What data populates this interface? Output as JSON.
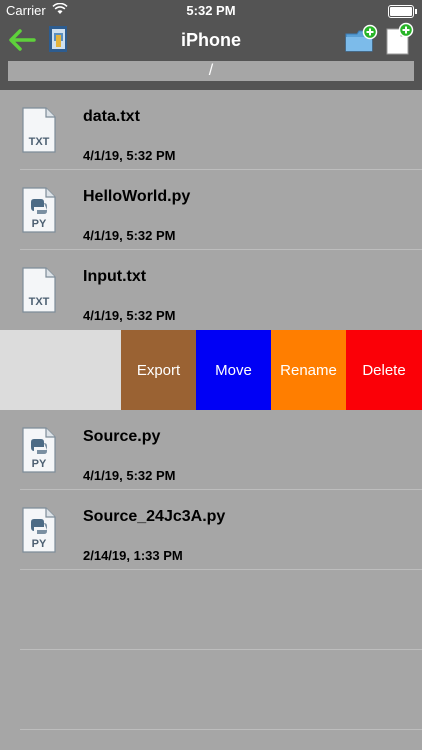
{
  "status_bar": {
    "carrier": "Carrier",
    "time": "5:32 PM"
  },
  "navbar": {
    "title": "iPhone",
    "back_icon": "arrow-left-icon",
    "app_icon": "app-document-icon",
    "new_folder_icon": "folder-add-icon",
    "new_file_icon": "file-add-icon"
  },
  "path": "/",
  "files": [
    {
      "name": "data.txt",
      "date": "4/1/19, 5:32 PM",
      "type": "TXT"
    },
    {
      "name": "HelloWorld.py",
      "date": "4/1/19, 5:32 PM",
      "type": "PY"
    },
    {
      "name": "Input.txt",
      "date": "4/1/19, 5:32 PM",
      "type": "TXT"
    },
    {
      "name": "Source.py",
      "date": "4/1/19, 5:32 PM",
      "type": "PY"
    },
    {
      "name": "Source_24Jc3A.py",
      "date": "2/14/19, 1:33 PM",
      "type": "PY"
    }
  ],
  "swipe_actions": {
    "export": "Export",
    "move": "Move",
    "rename": "Rename",
    "delete": "Delete"
  },
  "colors": {
    "export": "#9a6233",
    "move": "#0000f5",
    "rename": "#ff7e00",
    "delete": "#fb0007",
    "back_arrow": "#5ed13b",
    "add_badge": "#28b428"
  }
}
